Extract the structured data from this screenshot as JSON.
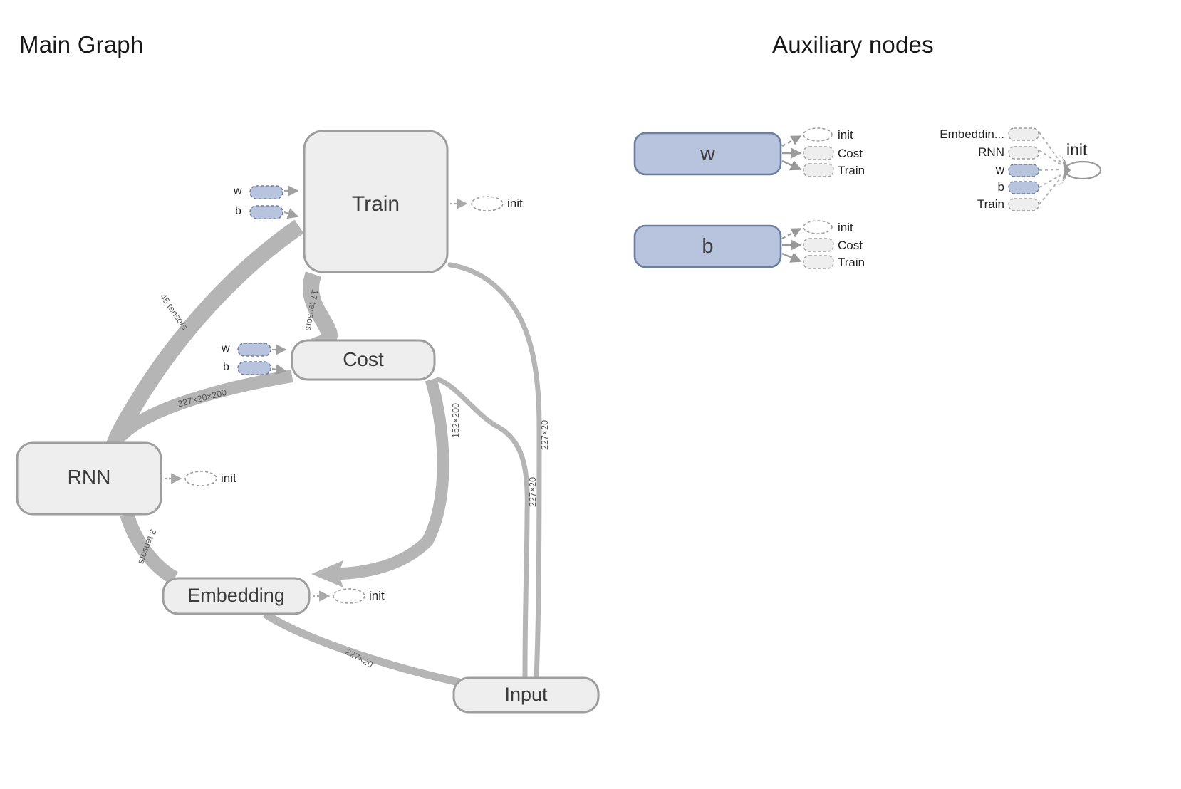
{
  "sections": {
    "main_graph_title": "Main Graph",
    "auxiliary_title": "Auxiliary nodes"
  },
  "main_graph": {
    "nodes": [
      {
        "id": "train",
        "label": "Train",
        "type": "group"
      },
      {
        "id": "cost",
        "label": "Cost",
        "type": "group"
      },
      {
        "id": "rnn",
        "label": "RNN",
        "type": "group"
      },
      {
        "id": "embedding",
        "label": "Embedding",
        "type": "group"
      },
      {
        "id": "input",
        "label": "Input",
        "type": "group"
      }
    ],
    "annotations": [
      {
        "id": "train-init",
        "label": "init"
      },
      {
        "id": "rnn-init",
        "label": "init"
      },
      {
        "id": "embedding-init",
        "label": "init"
      }
    ],
    "variable_stubs": [
      {
        "id": "train-w",
        "label": "w"
      },
      {
        "id": "train-b",
        "label": "b"
      },
      {
        "id": "cost-w",
        "label": "w"
      },
      {
        "id": "cost-b",
        "label": "b"
      }
    ],
    "edge_labels": [
      {
        "id": "train-rnn",
        "label": "45 tensors"
      },
      {
        "id": "train-cost",
        "label": "17 tensors"
      },
      {
        "id": "rnn-cost",
        "label": "227×20×200"
      },
      {
        "id": "rnn-embedding",
        "label": "3 tensors"
      },
      {
        "id": "cost-embedding",
        "label": "152×200"
      },
      {
        "id": "input-embedding",
        "label": "227×20"
      },
      {
        "id": "input-cost",
        "label": "227×20"
      },
      {
        "id": "input-train",
        "label": "227×20"
      }
    ]
  },
  "auxiliary_nodes": {
    "variables": [
      {
        "id": "aux-w",
        "label": "w",
        "outputs": [
          {
            "label": "init",
            "shape": "ellipse"
          },
          {
            "label": "Cost",
            "shape": "rect"
          },
          {
            "label": "Train",
            "shape": "rect"
          }
        ]
      },
      {
        "id": "aux-b",
        "label": "b",
        "outputs": [
          {
            "label": "init",
            "shape": "ellipse"
          },
          {
            "label": "Cost",
            "shape": "rect"
          },
          {
            "label": "Train",
            "shape": "rect"
          }
        ]
      }
    ],
    "init_cluster": {
      "id": "aux-init",
      "label": "init",
      "inputs": [
        {
          "label": "Embeddin...",
          "kind": "op"
        },
        {
          "label": "RNN",
          "kind": "op"
        },
        {
          "label": "w",
          "kind": "variable"
        },
        {
          "label": "b",
          "kind": "variable"
        },
        {
          "label": "Train",
          "kind": "op"
        }
      ]
    }
  },
  "colors": {
    "group_fill": "#eeeeee",
    "group_stroke": "#9e9e9e",
    "variable_fill": "#b8c4de",
    "variable_stroke": "#6d7f9e",
    "edge": "#b5b5b5",
    "thin_edge": "#b5b5b5",
    "arrow": "#9e9e9e",
    "stub_fill": "#eeeeee",
    "stub_stroke": "#9e9e9e",
    "text": "#212121",
    "edge_label_text": "#555555"
  }
}
